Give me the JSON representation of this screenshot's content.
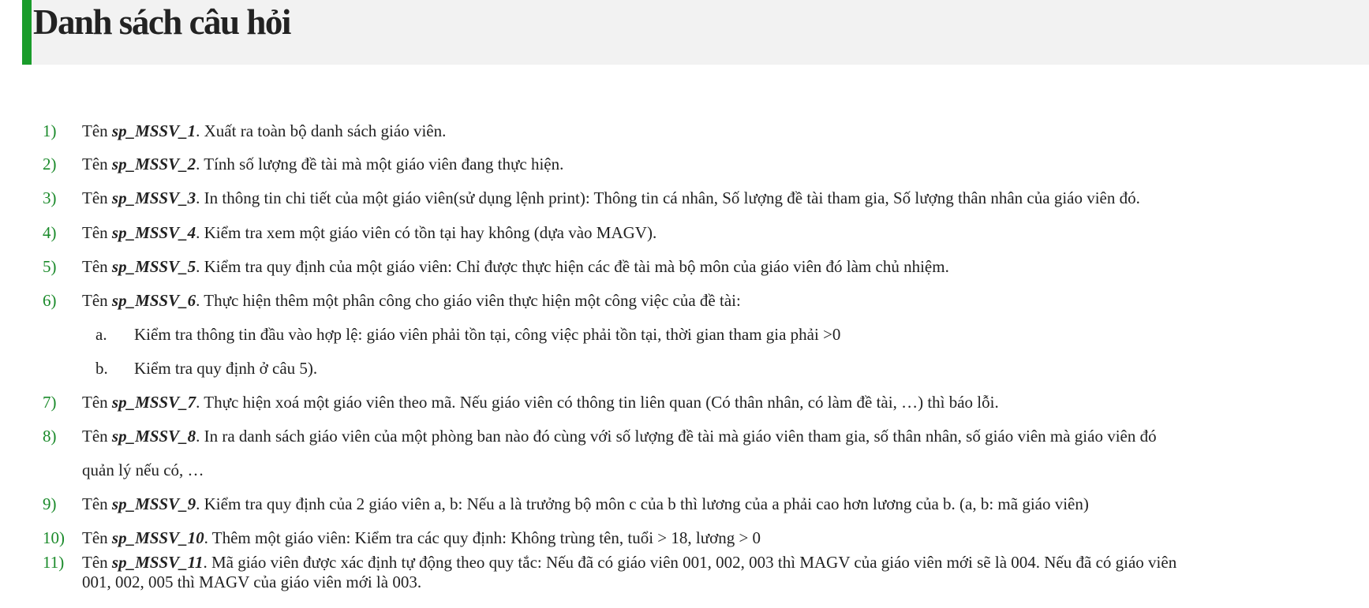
{
  "header": {
    "title": "Danh sách câu hỏi"
  },
  "colors": {
    "accent": "#1a9c2b",
    "number": "#1a8a2a",
    "header_bg": "#f2f2f2"
  },
  "questions": [
    {
      "num": "1)",
      "prefix": "Tên ",
      "code": "sp_MSSV_1",
      "text": ". Xuất ra toàn bộ danh sách giáo viên."
    },
    {
      "num": "2)",
      "prefix": "Tên ",
      "code": "sp_MSSV_2",
      "text": ". Tính số lượng đề tài mà một giáo viên đang thực hiện."
    },
    {
      "num": "3)",
      "prefix": "Tên ",
      "code": "sp_MSSV_3",
      "text": ". In thông tin chi tiết của một giáo viên(sử dụng lệnh print): Thông tin cá nhân, Số lượng đề tài tham gia, Số lượng thân nhân của giáo viên đó."
    },
    {
      "num": "4)",
      "prefix": "Tên ",
      "code": "sp_MSSV_4",
      "text": ". Kiểm tra xem một giáo viên có tồn tại hay không (dựa vào MAGV)."
    },
    {
      "num": "5)",
      "prefix": "Tên ",
      "code": "sp_MSSV_5",
      "text": ". Kiểm tra quy định của một giáo viên: Chỉ được thực hiện các đề tài mà bộ môn của giáo viên đó làm chủ nhiệm."
    },
    {
      "num": "6)",
      "prefix": "Tên ",
      "code": "sp_MSSV_6",
      "text": ". Thực hiện thêm một phân công cho giáo viên thực hiện một công việc của đề tài:"
    },
    {
      "num": "7)",
      "prefix": "Tên ",
      "code": "sp_MSSV_7",
      "text": ". Thực hiện xoá một giáo viên theo mã. Nếu giáo viên có thông tin liên quan (Có thân nhân, có làm đề tài, …) thì báo lỗi."
    },
    {
      "num": "8)",
      "prefix": "Tên ",
      "code": "sp_MSSV_8",
      "text": ". In ra danh sách giáo viên của một phòng ban nào đó cùng với số lượng đề tài mà giáo viên tham gia, số thân nhân, số giáo viên mà giáo viên đó",
      "text2": "quản lý nếu có, …"
    },
    {
      "num": "9)",
      "prefix": "Tên ",
      "code": "sp_MSSV_9",
      "text": ". Kiểm tra quy định của 2 giáo viên a, b: Nếu a là trưởng bộ môn c của b thì lương của a phải cao hơn lương của b. (a, b: mã giáo viên)"
    },
    {
      "num": "10)",
      "prefix": "Tên ",
      "code": "sp_MSSV_10",
      "text": ". Thêm một giáo viên: Kiểm tra các quy định: Không trùng tên, tuổi > 18, lương > 0"
    },
    {
      "num": "11)",
      "prefix": "Tên ",
      "code": "sp_MSSV_11",
      "text": ". Mã giáo viên được xác định tự động theo quy tắc: Nếu đã có giáo viên 001, 002, 003 thì MAGV của giáo viên mới sẽ là 004. Nếu đã có giáo viên",
      "text2": "001, 002, 005 thì MAGV của giáo viên mới là 003."
    }
  ],
  "subitems": [
    {
      "letter": "a.",
      "text": "Kiểm tra thông tin đầu vào hợp lệ: giáo viên phải tồn tại, công việc phải tồn tại, thời gian tham gia phải >0"
    },
    {
      "letter": "b.",
      "text": "Kiểm tra quy định ở câu 5)."
    }
  ]
}
